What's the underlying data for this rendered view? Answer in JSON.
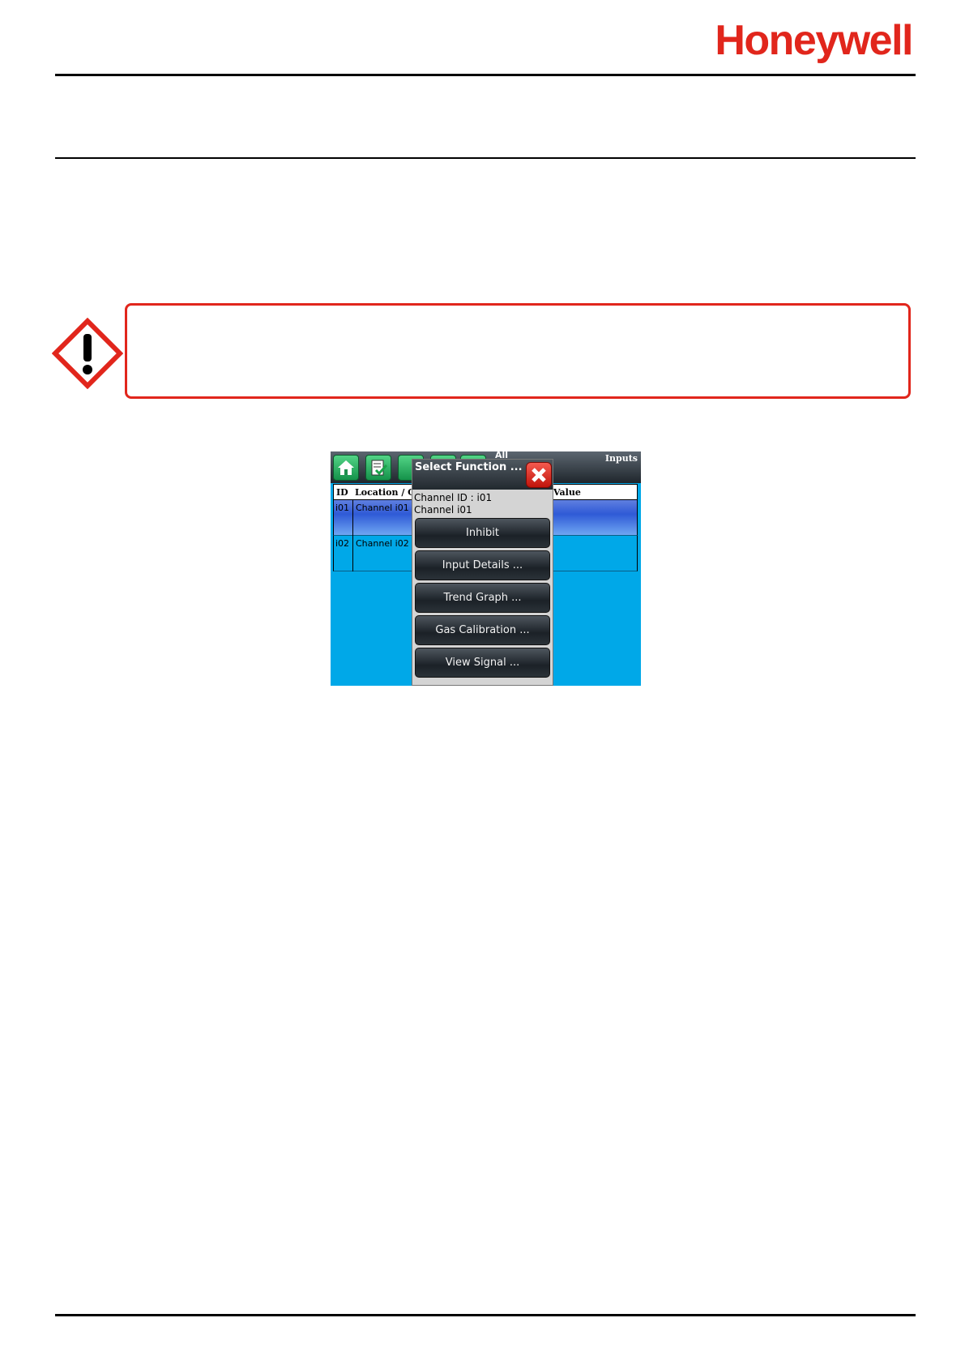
{
  "header": {
    "brand": "Honeywell"
  },
  "screen": {
    "toolbar": {
      "all_label": "All",
      "section_label": "Inputs"
    },
    "grid": {
      "columns": [
        "ID",
        "Location / C",
        "Value"
      ],
      "rows": [
        {
          "id": "i01",
          "location": "Channel i01",
          "selected": true
        },
        {
          "id": "i02",
          "location": "Channel i02",
          "selected": false
        }
      ]
    },
    "dialog": {
      "title": "Select Function ...",
      "channel_id_line": "Channel ID : i01",
      "channel_name_line": "Channel i01",
      "buttons": [
        "Inhibit",
        "Input Details ...",
        "Trend Graph ...",
        "Gas Calibration ...",
        "View Signal ..."
      ]
    }
  },
  "colors": {
    "brand_red": "#e1261c",
    "screen_blue": "#00a8e8"
  },
  "icons": [
    "warning-diamond-icon",
    "home-icon",
    "checklist-icon",
    "close-icon"
  ]
}
